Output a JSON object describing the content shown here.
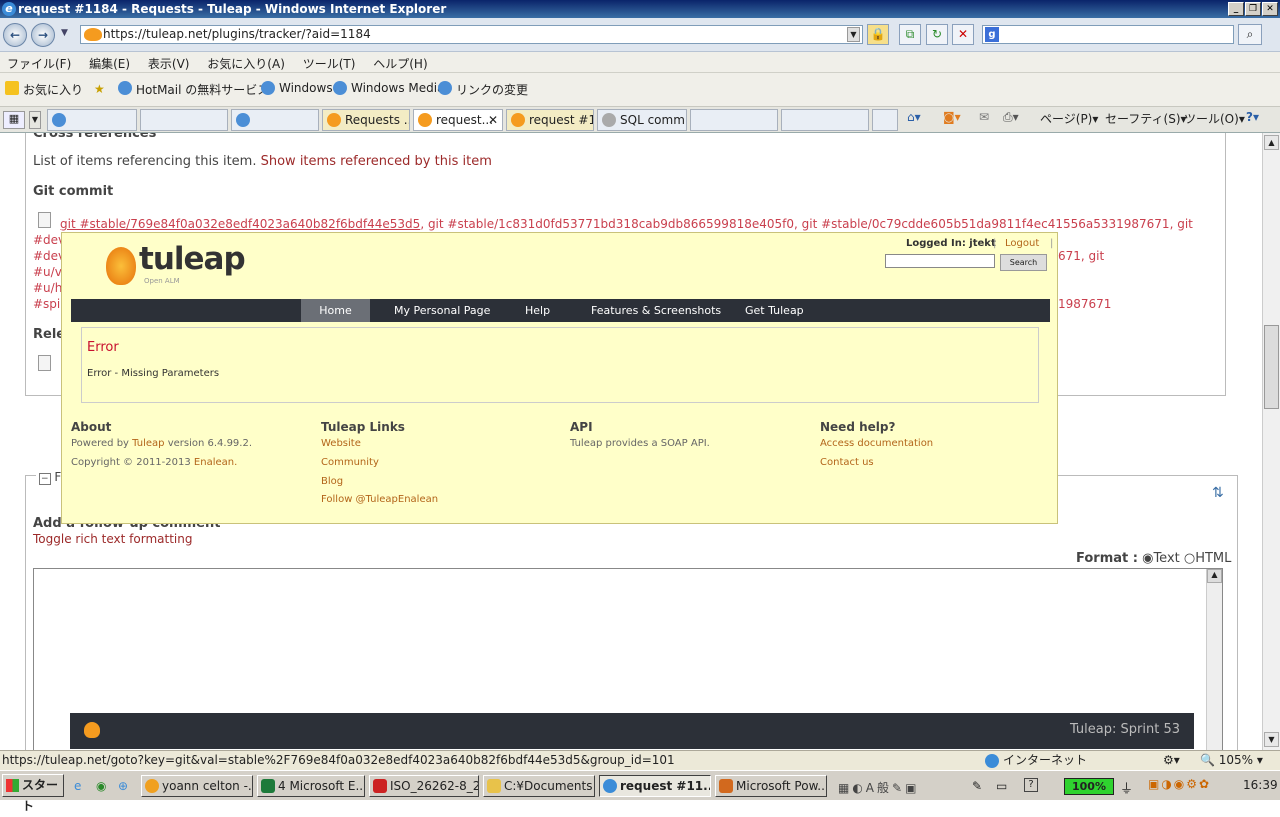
{
  "window": {
    "title": "request #1184 - Requests - Tuleap - Windows Internet Explorer"
  },
  "address": {
    "url": "https://tuleap.net/plugins/tracker/?aid=1184"
  },
  "menubar": [
    "ファイル(F)",
    "編集(E)",
    "表示(V)",
    "お気に入り(A)",
    "ツール(T)",
    "ヘルプ(H)"
  ],
  "favorites": {
    "label": "お気に入り",
    "items": [
      "HotMail の無料サービス",
      "Windows",
      "Windows Media",
      "リンクの変更"
    ]
  },
  "tabs": [
    "",
    "",
    "Requests ...",
    "request...",
    "request #1...",
    "SQL comm...",
    "",
    ""
  ],
  "toolbar_right": {
    "page": "ページ(P)",
    "safety": "セーフティ(S)",
    "tools": "ツール(O)"
  },
  "page": {
    "cross_ref_heading": "Cross references",
    "cross_ref_text": "List of items referencing this item.",
    "cross_ref_link": "Show items referenced by this item",
    "git_heading": "Git commit",
    "git_line1_first": "git #stable/769e84f0a032e8edf4023a640b82f6bdf44e53d5",
    "git_line1_rest": ", git #stable/1c831d0fd53771bd318cab9db866599818e405f0, git #stable/0c79cdde605b51da9811f4ec41556a5331987671, git",
    "git_left": [
      "#dev",
      "#dev",
      "#u/va",
      "#u/hl",
      "#spik"
    ],
    "git_right": [
      "671, git",
      "1987671"
    ],
    "related_heading": "Rele",
    "followup_legend": "Fo",
    "followup_heading": "Add a follow-up comment",
    "toggle_rich": "Toggle rich text formatting",
    "format_label": "Format :",
    "format_text": "Text",
    "format_html": "HTML",
    "footer_sprint": "Tuleap: Sprint 53"
  },
  "popup": {
    "logo_text": "tuleap",
    "logo_sub": "Open ALM",
    "logged_in": "Logged In: jtekt",
    "logout": "Logout",
    "search_button": "Search",
    "nav": [
      "Home",
      "My Personal Page",
      "Help",
      "Features & Screenshots",
      "Get Tuleap"
    ],
    "error_title": "Error",
    "error_message": "Error - Missing Parameters",
    "footer": {
      "about_title": "About",
      "powered_prefix": "Powered by",
      "powered_link": "Tuleap",
      "powered_suffix": "version 6.4.99.2.",
      "copyright_prefix": "Copyright © 2011-2013",
      "copyright_link": "Enalean.",
      "links_title": "Tuleap Links",
      "links": [
        "Website",
        "Community",
        "Blog",
        "Follow @TuleapEnalean"
      ],
      "api_title": "API",
      "api_text": "Tuleap provides a SOAP API.",
      "help_title": "Need help?",
      "help_links": [
        "Access documentation",
        "Contact us"
      ]
    }
  },
  "statusbar": {
    "url": "https://tuleap.net/goto?key=git&val=stable%2F769e84f0a032e8edf4023a640b82f6bdf44e53d5&group_id=101",
    "zone": "インターネット",
    "zoom": "105%"
  },
  "taskbar": {
    "start": "スタート",
    "tasks": [
      "yoann celton -...",
      "4 Microsoft E...",
      "ISO_26262-8_2...",
      "C:¥Documents ...",
      "request #11...",
      "Microsoft Pow..."
    ],
    "battery": "100%",
    "clock": "16:39"
  }
}
